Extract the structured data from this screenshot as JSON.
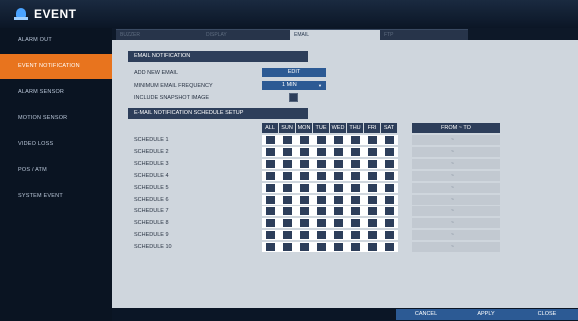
{
  "app": {
    "title": "EVENT"
  },
  "sidebar": {
    "items": [
      {
        "label": "ALARM OUT"
      },
      {
        "label": "EVENT NOTIFICATION"
      },
      {
        "label": "ALARM SENSOR"
      },
      {
        "label": "MOTION SENSOR"
      },
      {
        "label": "VIDEO LOSS"
      },
      {
        "label": "POS / ATM"
      },
      {
        "label": "SYSTEM EVENT"
      }
    ],
    "active_index": 1
  },
  "tabs": [
    {
      "label": "BUZZER"
    },
    {
      "label": "DISPLAY"
    },
    {
      "label": "EMAIL"
    },
    {
      "label": "FTP"
    }
  ],
  "email_notification": {
    "header": "EMAIL NOTIFICATION",
    "add_new_email_label": "ADD NEW EMAIL",
    "edit_button": "EDIT",
    "frequency_label": "MINIMUM EMAIL FREQUENCY",
    "frequency_value": "1 MIN",
    "snapshot_label": "INCLUDE SNAPSHOT IMAGE"
  },
  "schedule_setup": {
    "header": "E-MAIL NOTIFICATION SCHEDULE SETUP",
    "columns": [
      "ALL",
      "SUN",
      "MON",
      "TUE",
      "WED",
      "THU",
      "FRI",
      "SAT"
    ],
    "time_header": "FROM ~ TO",
    "time_separator": "~",
    "rows": [
      "SCHEDULE 1",
      "SCHEDULE 2",
      "SCHEDULE 3",
      "SCHEDULE 4",
      "SCHEDULE 5",
      "SCHEDULE 6",
      "SCHEDULE 7",
      "SCHEDULE 8",
      "SCHEDULE 9",
      "SCHEDULE 10"
    ]
  },
  "footer": {
    "cancel": "CANCEL",
    "apply": "APPLY",
    "close": "CLOSE"
  },
  "colors": {
    "active_accent": "#e8741e",
    "button_blue": "#2c5a94",
    "header_navy": "#2d3e5a"
  }
}
